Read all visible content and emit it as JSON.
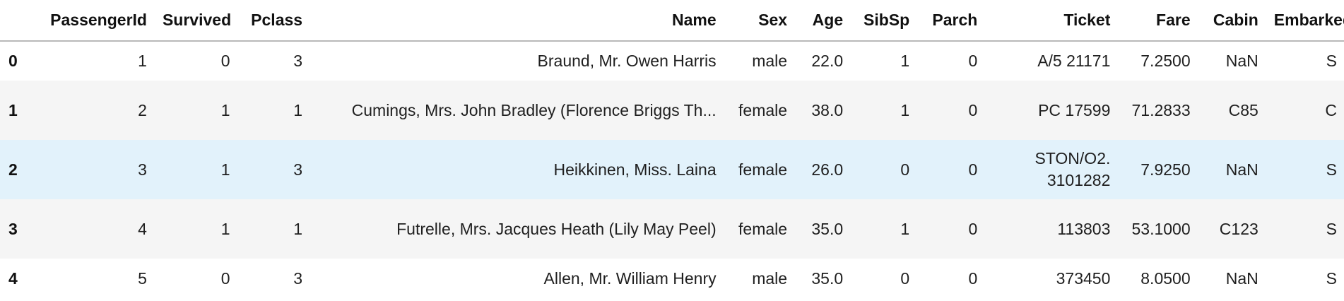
{
  "table": {
    "columns": [
      "",
      "PassengerId",
      "Survived",
      "Pclass",
      "Name",
      "Sex",
      "Age",
      "SibSp",
      "Parch",
      "Ticket",
      "Fare",
      "Cabin",
      "Embarked"
    ],
    "rows": [
      {
        "index": "0",
        "PassengerId": "1",
        "Survived": "0",
        "Pclass": "3",
        "Name": "Braund, Mr. Owen Harris",
        "Sex": "male",
        "Age": "22.0",
        "SibSp": "1",
        "Parch": "0",
        "Ticket": "A/5 21171",
        "Fare": "7.2500",
        "Cabin": "NaN",
        "Embarked": "S"
      },
      {
        "index": "1",
        "PassengerId": "2",
        "Survived": "1",
        "Pclass": "1",
        "Name": "Cumings, Mrs. John Bradley (Florence Briggs Th...",
        "Sex": "female",
        "Age": "38.0",
        "SibSp": "1",
        "Parch": "0",
        "Ticket": "PC 17599",
        "Fare": "71.2833",
        "Cabin": "C85",
        "Embarked": "C"
      },
      {
        "index": "2",
        "PassengerId": "3",
        "Survived": "1",
        "Pclass": "3",
        "Name": "Heikkinen, Miss. Laina",
        "Sex": "female",
        "Age": "26.0",
        "SibSp": "0",
        "Parch": "0",
        "Ticket": "STON/O2. 3101282",
        "Fare": "7.9250",
        "Cabin": "NaN",
        "Embarked": "S"
      },
      {
        "index": "3",
        "PassengerId": "4",
        "Survived": "1",
        "Pclass": "1",
        "Name": "Futrelle, Mrs. Jacques Heath (Lily May Peel)",
        "Sex": "female",
        "Age": "35.0",
        "SibSp": "1",
        "Parch": "0",
        "Ticket": "113803",
        "Fare": "53.1000",
        "Cabin": "C123",
        "Embarked": "S"
      },
      {
        "index": "4",
        "PassengerId": "5",
        "Survived": "0",
        "Pclass": "3",
        "Name": "Allen, Mr. William Henry",
        "Sex": "male",
        "Age": "35.0",
        "SibSp": "0",
        "Parch": "0",
        "Ticket": "373450",
        "Fare": "8.0500",
        "Cabin": "NaN",
        "Embarked": "S"
      }
    ]
  },
  "colors": {
    "row_alt": "#f5f5f5",
    "row_hover": "#e2f2fb",
    "header_border": "#b9b9b9"
  }
}
